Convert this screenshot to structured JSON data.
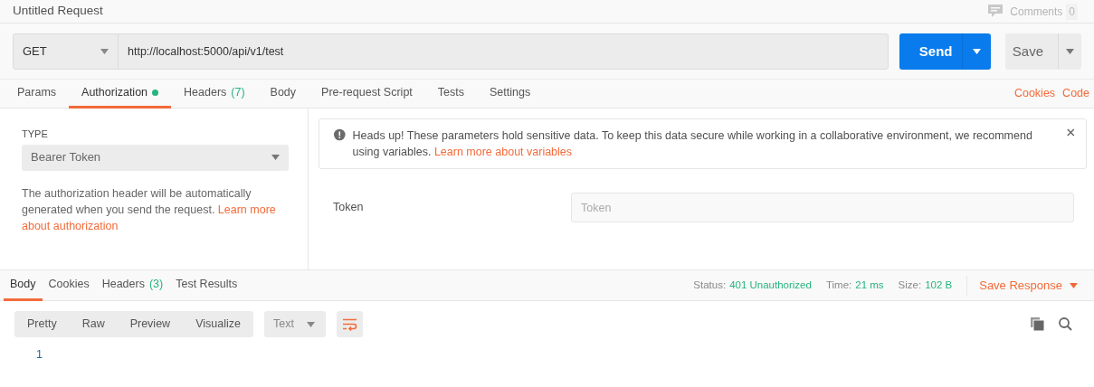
{
  "title": "Untitled Request",
  "comments": {
    "label": "Comments",
    "count": "0"
  },
  "request": {
    "method": "GET",
    "url": "http://localhost:5000/api/v1/test",
    "send": "Send",
    "save": "Save"
  },
  "request_tabs": [
    {
      "label": "Params",
      "selected": false,
      "dot": false
    },
    {
      "label": "Authorization",
      "selected": true,
      "dot": true
    },
    {
      "label": "Headers",
      "count": "(7)",
      "selected": false,
      "dot": false
    },
    {
      "label": "Body",
      "selected": false,
      "dot": false
    },
    {
      "label": "Pre-request Script",
      "selected": false,
      "dot": false
    },
    {
      "label": "Tests",
      "selected": false,
      "dot": false
    },
    {
      "label": "Settings",
      "selected": false,
      "dot": false
    }
  ],
  "request_links": [
    "Cookies",
    "Code"
  ],
  "auth": {
    "type_label": "TYPE",
    "type_value": "Bearer Token",
    "description": "The authorization header will be automatically generated when you send the request.",
    "link_lines": [
      "Learn more",
      "about authorization"
    ]
  },
  "notice": {
    "text": "Heads up! These parameters hold sensitive data. To keep this data secure while working in a collaborative environment, we recommend using variables.",
    "link": "Learn more about variables"
  },
  "token": {
    "label": "Token",
    "placeholder": "Token"
  },
  "response_tabs": [
    {
      "label": "Body",
      "selected": true
    },
    {
      "label": "Cookies",
      "selected": false
    },
    {
      "label": "Headers",
      "count": "(3)",
      "selected": false
    },
    {
      "label": "Test Results",
      "selected": false
    }
  ],
  "status": [
    {
      "label": "Status:",
      "value": "401 Unauthorized"
    },
    {
      "label": "Time:",
      "value": "21 ms"
    },
    {
      "label": "Size:",
      "value": "102 B"
    }
  ],
  "save_response": "Save Response",
  "view_modes": [
    "Pretty",
    "Raw",
    "Preview",
    "Visualize"
  ],
  "format": "Text",
  "line_numbers": [
    "1"
  ]
}
